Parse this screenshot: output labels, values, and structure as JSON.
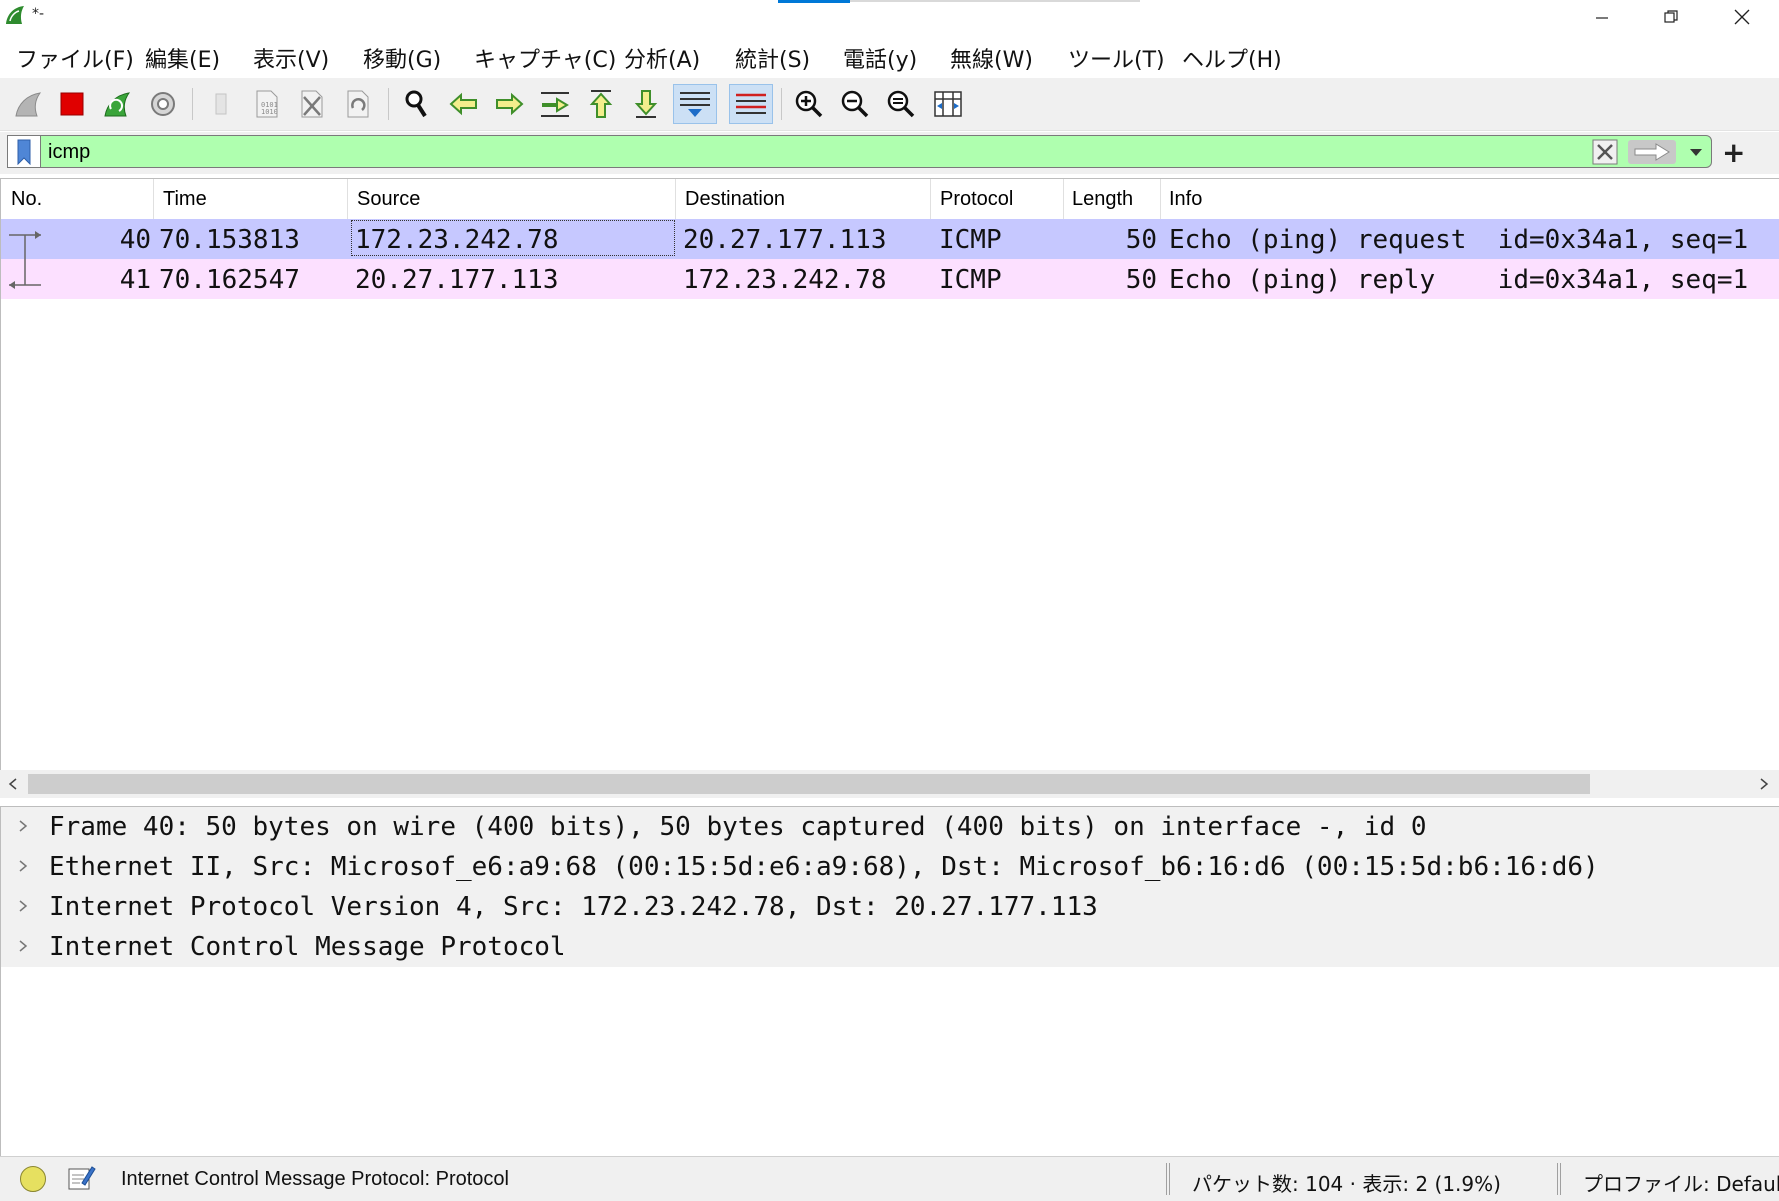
{
  "window": {
    "title": "*-"
  },
  "menu": {
    "items": [
      "ファイル(F)",
      "編集(E)",
      "表示(V)",
      "移動(G)",
      "キャプチャ(C)",
      "分析(A)",
      "統計(S)",
      "電話(y)",
      "無線(W)",
      "ツール(T)",
      "ヘルプ(H)"
    ]
  },
  "toolbar": {
    "icons": [
      "shark-fin-start-icon",
      "stop-capture-icon",
      "restart-capture-icon",
      "capture-options-icon",
      "open-file-icon",
      "save-file-icon",
      "close-file-icon",
      "reload-file-icon",
      "find-packet-icon",
      "go-back-icon",
      "go-forward-icon",
      "go-to-packet-icon",
      "first-packet-icon",
      "last-packet-icon",
      "autoscroll-icon",
      "colorize-icon",
      "zoom-in-icon",
      "zoom-out-icon",
      "normal-size-icon",
      "resize-columns-icon"
    ],
    "active": [
      "autoscroll-icon",
      "colorize-icon"
    ]
  },
  "filter": {
    "value": "icmp",
    "background": "#afffaf"
  },
  "packet_list": {
    "columns": [
      "No.",
      "Time",
      "Source",
      "Destination",
      "Protocol",
      "Length",
      "Info"
    ],
    "rows": [
      {
        "no": "40",
        "time": "70.153813",
        "source": "172.23.242.78",
        "destination": "20.27.177.113",
        "protocol": "ICMP",
        "length": "50",
        "info": "Echo (ping) request  id=0x34a1, seq=1",
        "color": "#c6c8ff"
      },
      {
        "no": "41",
        "time": "70.162547",
        "source": "20.27.177.113",
        "destination": "172.23.242.78",
        "protocol": "ICMP",
        "length": "50",
        "info": "Echo (ping) reply    id=0x34a1, seq=1",
        "color": "#fce0ff"
      }
    ]
  },
  "details": {
    "lines": [
      "Frame 40: 50 bytes on wire (400 bits), 50 bytes captured (400 bits) on interface -, id 0",
      "Ethernet II, Src: Microsof_e6:a9:68 (00:15:5d:e6:a9:68), Dst: Microsof_b6:16:d6 (00:15:5d:b6:16:d6)",
      "Internet Protocol Version 4, Src: 172.23.242.78, Dst: 20.27.177.113",
      "Internet Control Message Protocol"
    ]
  },
  "status": {
    "field_info": "Internet Control Message Protocol: Protocol",
    "packets": "パケット数: 104 · 表示: 2 (1.9%)",
    "profile": "プロファイル: Default"
  }
}
